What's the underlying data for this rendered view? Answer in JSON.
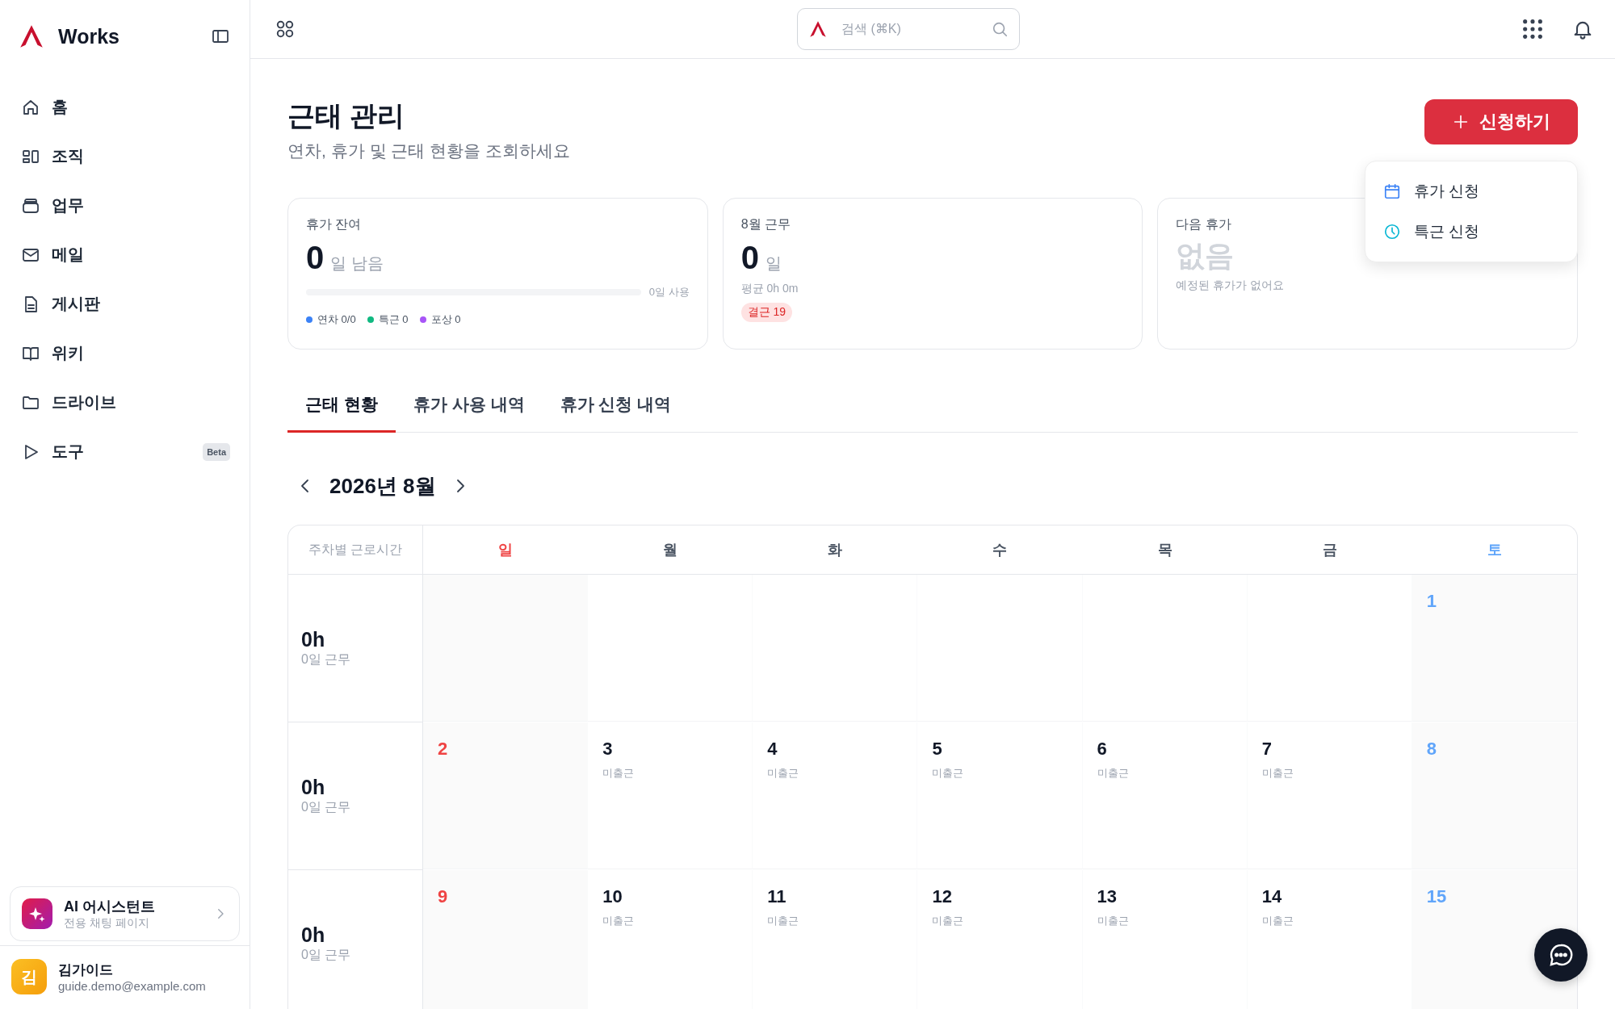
{
  "sidebar": {
    "logo": "Works",
    "items": [
      {
        "label": "홈"
      },
      {
        "label": "조직"
      },
      {
        "label": "업무"
      },
      {
        "label": "메일"
      },
      {
        "label": "게시판"
      },
      {
        "label": "위키"
      },
      {
        "label": "드라이브"
      },
      {
        "label": "도구",
        "badge": "Beta"
      }
    ],
    "assistant": {
      "title": "AI 어시스턴트",
      "subtitle": "전용 채팅 페이지"
    },
    "user": {
      "avatar": "김",
      "name": "김가이드",
      "email": "guide.demo@example.com"
    }
  },
  "topbar": {
    "search": {
      "placeholder": "검색 (⌘K)"
    }
  },
  "page": {
    "title": "근태 관리",
    "subtitle": "연차, 휴가 및 근태 현황을 조회하세요",
    "apply_button": "신청하기",
    "menu": [
      {
        "label": "휴가 신청"
      },
      {
        "label": "특근 신청"
      }
    ]
  },
  "cards": [
    {
      "kind": "balance",
      "label": "휴가 잔여",
      "value": "0",
      "unit": "일 남음",
      "level": 0,
      "used": "0일 사용",
      "legend": [
        {
          "label": "연차 0/0",
          "color": "#3b82f6"
        },
        {
          "label": "특근 0",
          "color": "#10b981"
        },
        {
          "label": "포상 0",
          "color": "#a855f7"
        }
      ]
    },
    {
      "kind": "work",
      "label": "8월 근무",
      "value": "0",
      "unit": "일",
      "note": "평균 0h 0m",
      "badge": "결근 19"
    },
    {
      "kind": "next",
      "label": "다음 휴가",
      "value": "없음",
      "note": "예정된 휴가가 없어요"
    }
  ],
  "tabs": [
    {
      "label": "근태 현황",
      "selected": true
    },
    {
      "label": "휴가 사용 내역",
      "selected": false
    },
    {
      "label": "휴가 신청 내역",
      "selected": false
    }
  ],
  "calendar": {
    "month": "2026년 8월",
    "week_header": "주차별 근로시간",
    "weekdays": [
      {
        "label": "일",
        "kind": "sun"
      },
      {
        "label": "월",
        "kind": "weekday"
      },
      {
        "label": "화",
        "kind": "weekday"
      },
      {
        "label": "수",
        "kind": "weekday"
      },
      {
        "label": "목",
        "kind": "weekday"
      },
      {
        "label": "금",
        "kind": "weekday"
      },
      {
        "label": "토",
        "kind": "sat"
      }
    ],
    "weeks": [
      {
        "hours": "0h",
        "worked": "0일 근무",
        "days": [
          {
            "date": "1"
          }
        ]
      },
      {
        "hours": "0h",
        "worked": "0일 근무",
        "days": [
          {
            "date": "2"
          },
          {
            "date": "3",
            "status": "미출근"
          },
          {
            "date": "4",
            "status": "미출근"
          },
          {
            "date": "5",
            "status": "미출근"
          },
          {
            "date": "6",
            "status": "미출근"
          },
          {
            "date": "7",
            "status": "미출근"
          },
          {
            "date": "8"
          }
        ]
      },
      {
        "hours": "0h",
        "worked": "0일 근무",
        "days": [
          {
            "date": "9"
          },
          {
            "date": "10",
            "status": "미출근"
          },
          {
            "date": "11",
            "status": "미출근"
          },
          {
            "date": "12",
            "status": "미출근"
          },
          {
            "date": "13",
            "status": "미출근"
          },
          {
            "date": "14",
            "status": "미출근"
          },
          {
            "date": "15"
          }
        ]
      }
    ]
  }
}
